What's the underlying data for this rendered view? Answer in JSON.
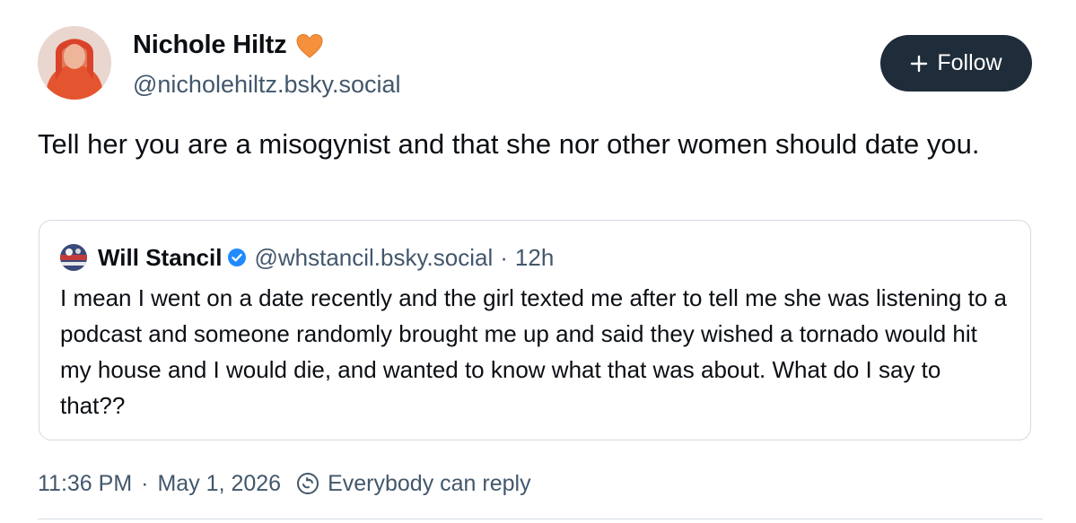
{
  "author": {
    "name": "Nichole Hiltz",
    "handle": "@nicholehiltz.bsky.social",
    "badge_icon": "orange-heart-icon"
  },
  "follow_button": {
    "label": "Follow",
    "icon": "plus-icon"
  },
  "post": {
    "text": "Tell her you are a misogynist and that she nor other women should date you."
  },
  "quote": {
    "name": "Will Stancil",
    "verified_icon": "verified-check-icon",
    "handle": "@whstancil.bsky.social",
    "separator": "·",
    "time": "12h",
    "text": "I mean I went on a date recently and the girl texted me after to tell me she was listening to a podcast and someone randomly brought me up and said they wished a tornado would hit my house and I would die, and wanted to know what that was about. What do I say to that??"
  },
  "footer": {
    "time": "11:36 PM",
    "separator": "·",
    "date": "May 1, 2026",
    "reply_icon": "reply-settings-icon",
    "reply_setting": "Everybody can reply"
  },
  "colors": {
    "heart": "#f5903c",
    "follow_bg": "#1f2c3a",
    "verified": "#208bfe",
    "secondary_text": "#42576c",
    "border": "#d4dbe2"
  }
}
